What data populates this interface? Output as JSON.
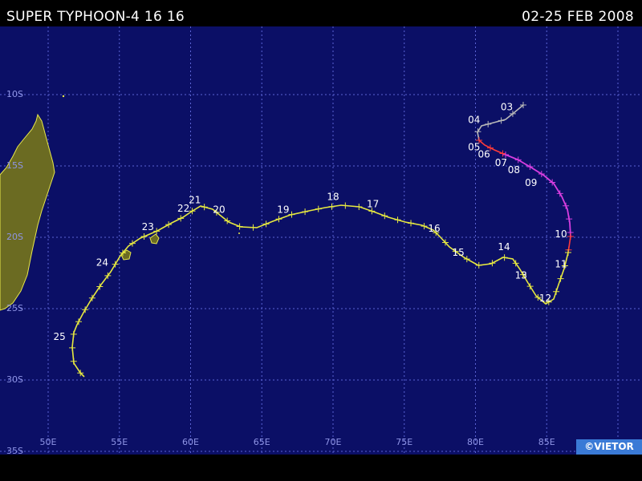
{
  "header": {
    "title": "SUPER TYPHOON-4 16 16",
    "date_range": "02-25 FEB 2008"
  },
  "watermark": "©VIETOR",
  "colors": {
    "ocean": "#0b0f66",
    "grid": "#5b63d4",
    "land": "#6b6b22",
    "coast": "#e8e84a",
    "track_weak": "#e6e840",
    "track_strong": "#d83ee0",
    "track_red": "#ff3a3a",
    "track_early": "#b8b8b8",
    "label": "#ffffff",
    "grid_label": "#8f95e6"
  },
  "map": {
    "lat_labels": [
      {
        "value": -10,
        "text": "10S"
      },
      {
        "value": -15,
        "text": "15S"
      },
      {
        "value": -20,
        "text": "20S"
      },
      {
        "value": -25,
        "text": "25S"
      },
      {
        "value": -30,
        "text": "30S"
      },
      {
        "value": -35,
        "text": "35S"
      }
    ],
    "lon_labels": [
      {
        "value": 50,
        "text": "50E"
      },
      {
        "value": 55,
        "text": "55E"
      },
      {
        "value": 60,
        "text": "60E"
      },
      {
        "value": 65,
        "text": "65E"
      },
      {
        "value": 70,
        "text": "70E"
      },
      {
        "value": 75,
        "text": "75E"
      },
      {
        "value": 80,
        "text": "80E"
      },
      {
        "value": 85,
        "text": "85E"
      }
    ]
  },
  "track": {
    "day_labels": [
      {
        "text": "03",
        "lon": 82.2,
        "lat": -11.1
      },
      {
        "text": "04",
        "lon": 79.9,
        "lat": -12.0
      },
      {
        "text": "05",
        "lon": 79.9,
        "lat": -13.9
      },
      {
        "text": "06",
        "lon": 80.6,
        "lat": -14.4
      },
      {
        "text": "07",
        "lon": 81.8,
        "lat": -15.0
      },
      {
        "text": "08",
        "lon": 82.7,
        "lat": -15.5
      },
      {
        "text": "09",
        "lon": 83.9,
        "lat": -16.4
      },
      {
        "text": "10",
        "lon": 86.0,
        "lat": -20.0
      },
      {
        "text": "11",
        "lon": 86.0,
        "lat": -22.1
      },
      {
        "text": "12",
        "lon": 84.9,
        "lat": -24.5
      },
      {
        "text": "13",
        "lon": 83.2,
        "lat": -22.9
      },
      {
        "text": "14",
        "lon": 82.0,
        "lat": -20.9
      },
      {
        "text": "15",
        "lon": 78.8,
        "lat": -21.3
      },
      {
        "text": "16",
        "lon": 77.1,
        "lat": -19.6
      },
      {
        "text": "17",
        "lon": 72.8,
        "lat": -17.9
      },
      {
        "text": "18",
        "lon": 70.0,
        "lat": -17.4
      },
      {
        "text": "19",
        "lon": 66.5,
        "lat": -18.3
      },
      {
        "text": "20",
        "lon": 62.0,
        "lat": -18.3
      },
      {
        "text": "21",
        "lon": 60.3,
        "lat": -17.6
      },
      {
        "text": "22",
        "lon": 59.5,
        "lat": -18.2
      },
      {
        "text": "23",
        "lon": 57.0,
        "lat": -19.5
      },
      {
        "text": "24",
        "lon": 53.8,
        "lat": -22.0
      },
      {
        "text": "25",
        "lon": 50.8,
        "lat": -27.2
      }
    ]
  }
}
